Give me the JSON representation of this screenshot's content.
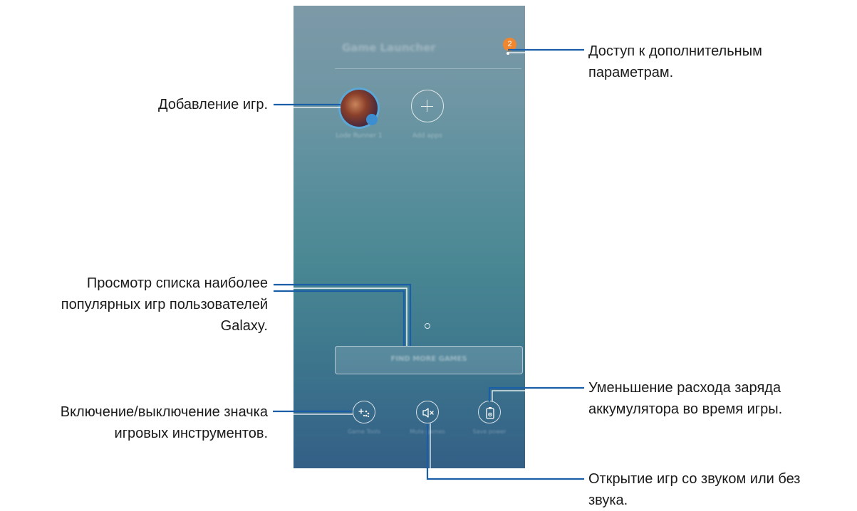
{
  "phone": {
    "title": "Game Launcher",
    "menu_badge": "2",
    "apps": [
      {
        "label": "Lode Runner 1"
      },
      {
        "label": "Add apps"
      }
    ],
    "find_more_button": "FIND MORE GAMES",
    "bottom_actions": [
      {
        "label": "Game Tools",
        "icon": "game-tools-icon"
      },
      {
        "label": "Mute games",
        "icon": "mute-icon"
      },
      {
        "label": "Save power",
        "icon": "battery-settings-icon"
      }
    ]
  },
  "callouts": {
    "more_options": [
      "Доступ к дополнительным",
      "параметрам."
    ],
    "add_games": [
      "Добавление игр."
    ],
    "popular_games": [
      "Просмотр списка наиболее",
      "популярных игр пользователей",
      "Galaxy."
    ],
    "game_tools": [
      "Включение/выключение значка",
      "игровых инструментов."
    ],
    "battery": [
      "Уменьшение расхода заряда",
      "аккумулятора во время игры."
    ],
    "sound": [
      "Открытие игр со звуком или без",
      "звука."
    ]
  },
  "colors": {
    "leader_line": "#1a5ea8",
    "badge": "#f0862e",
    "screen_top": "#7d99a8",
    "screen_bottom": "#335f86"
  }
}
